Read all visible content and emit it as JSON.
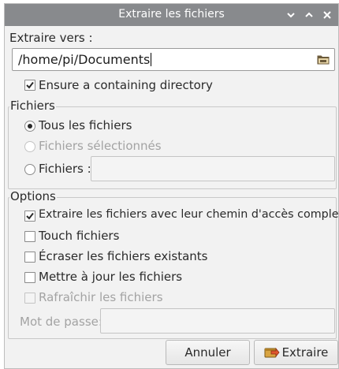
{
  "window": {
    "title": "Extraire les fichiers",
    "controls": [
      "chevron-down-icon",
      "chevron-up-icon",
      "close-icon"
    ]
  },
  "extract_to": {
    "label": "Extraire vers :",
    "path": "/home/pi/Documents",
    "ensure_dir_label": "Ensure a containing directory",
    "ensure_dir_checked": true
  },
  "files_group": {
    "legend": "Fichiers",
    "all_label": "Tous les fichiers",
    "all_selected": true,
    "selected_label": "Fichiers sélectionnés",
    "selected_enabled": false,
    "pattern_label": "Fichiers :",
    "pattern_value": ""
  },
  "options_group": {
    "legend": "Options",
    "items": [
      {
        "label": "Extraire les fichiers avec leur chemin d'accès complet",
        "checked": true,
        "enabled": true
      },
      {
        "label": "Touch fichiers",
        "checked": false,
        "enabled": true
      },
      {
        "label": "Écraser les fichiers existants",
        "checked": false,
        "enabled": true
      },
      {
        "label": "Mettre à jour les fichiers",
        "checked": false,
        "enabled": true
      },
      {
        "label": "Rafraîchir les fichiers",
        "checked": false,
        "enabled": false
      }
    ],
    "password_label": "Mot de passe:",
    "password_value": ""
  },
  "buttons": {
    "cancel_label": "Annuler",
    "extract_label": "Extraire"
  },
  "colors": {
    "titlebar": "#888a8d",
    "window_bg": "#f2f2f2",
    "disabled_text": "#a3a3a3"
  }
}
